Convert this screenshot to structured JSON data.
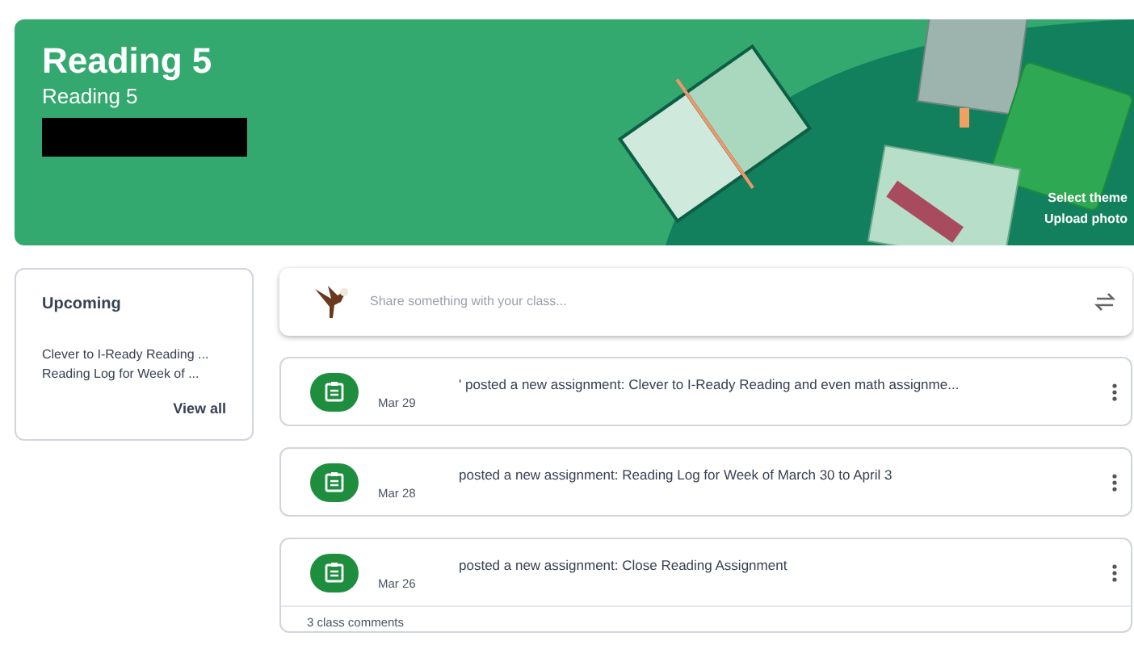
{
  "banner": {
    "title": "Reading 5",
    "subtitle": "Reading 5",
    "links": [
      "Select theme",
      "Upload photo"
    ]
  },
  "upcoming": {
    "title": "Upcoming",
    "items": [
      "Clever to I-Ready Reading ...",
      "Reading Log for Week of ..."
    ],
    "view_all": "View all"
  },
  "share": {
    "placeholder": "Share something with your class..."
  },
  "posts": [
    {
      "text": "' posted a new assignment: Clever to I-Ready Reading and even math assignme...",
      "date": "Mar 29"
    },
    {
      "text": "posted a new assignment: Reading Log for Week of March 30 to April 3",
      "date": "Mar 28"
    },
    {
      "text": "posted a new assignment: Close Reading Assignment",
      "date": "Mar 26",
      "comments": "3 class comments"
    }
  ]
}
